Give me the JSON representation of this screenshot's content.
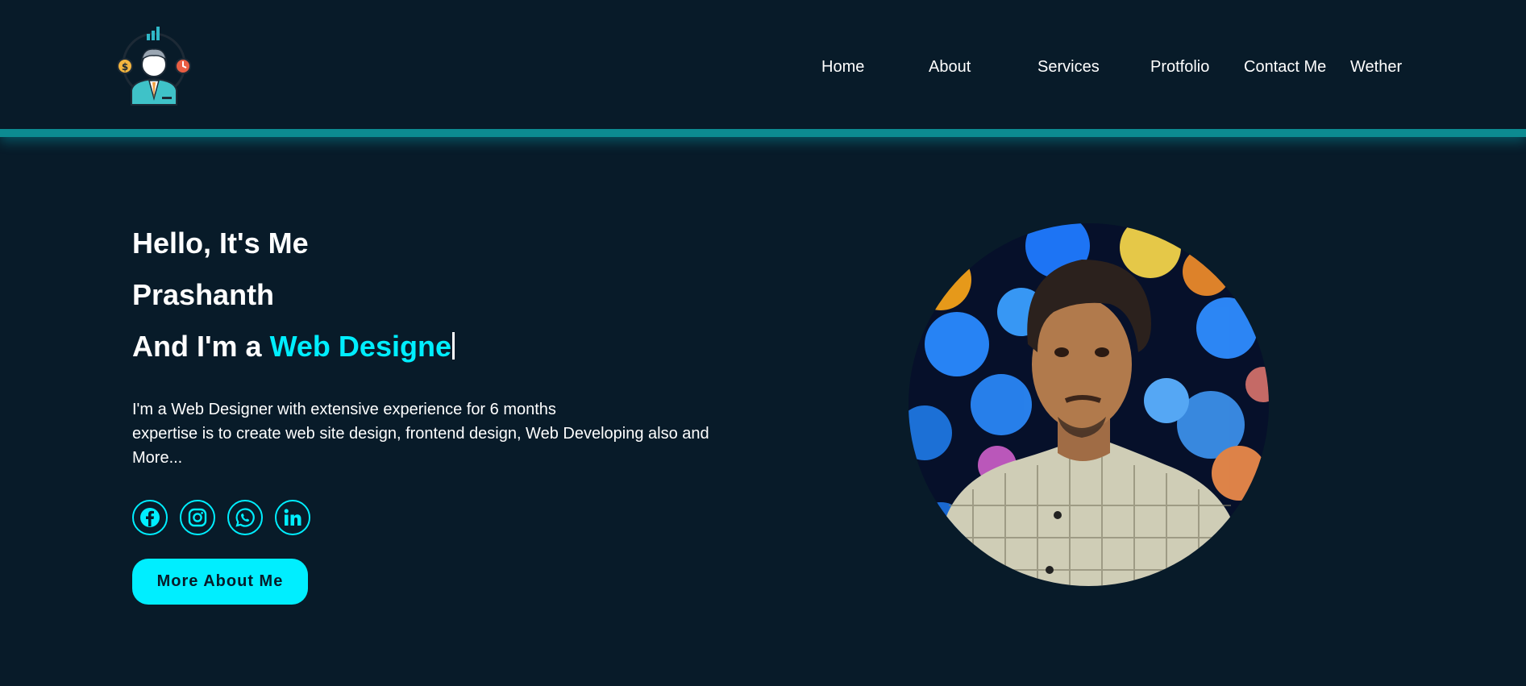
{
  "nav": {
    "items": [
      {
        "label": "Home"
      },
      {
        "label": "About"
      },
      {
        "label": "Services"
      },
      {
        "label": "Protfolio"
      },
      {
        "label": "Contact Me"
      },
      {
        "label": "Wether"
      }
    ]
  },
  "hero": {
    "greeting": "Hello, It's Me",
    "name": "Prashanth",
    "role_prefix": "And I'm a ",
    "role_typed": "Web Designe",
    "description_lines": [
      "I'm a Web Designer with extensive experience for 6 months",
      "expertise is to create web site design, frontend design, Web Developing also and",
      "More..."
    ],
    "socials": [
      {
        "icon": "facebook-icon"
      },
      {
        "icon": "instagram-icon"
      },
      {
        "icon": "whatsapp-icon"
      },
      {
        "icon": "linkedin-icon"
      }
    ],
    "button_label": "More About Me"
  },
  "colors": {
    "background": "#081b29",
    "accent": "#00eeff",
    "header_border": "#0c8b91",
    "text": "#ffffff"
  }
}
